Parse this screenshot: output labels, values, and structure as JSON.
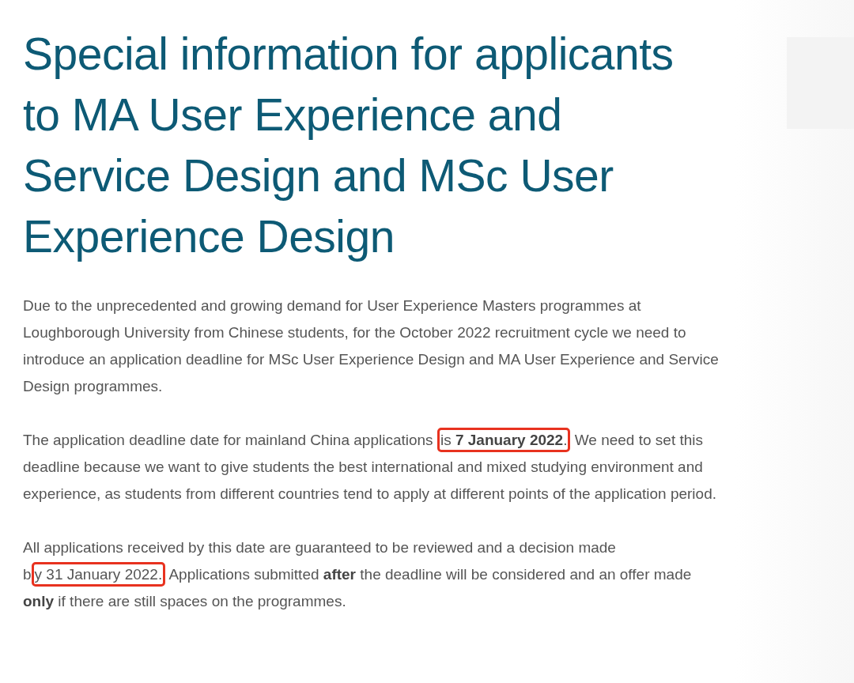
{
  "heading": "Special information for applicants to MA User Experience and Service Design and MSc User Experience Design",
  "paragraphs": [
    {
      "segments": [
        {
          "text": "Due to the unprecedented and growing demand for User Experience Masters programmes at Loughborough University from Chinese students, for the October 2022 recruitment cycle we need to introduce an application deadline for MSc User Experience Design and MA User Experience and Service Design programmes.",
          "highlighted": false
        }
      ]
    },
    {
      "segments": [
        {
          "text": "The application deadline date for mainland China applications ",
          "highlighted": false
        },
        {
          "text": "is **7 January 2022**.",
          "highlighted": true
        },
        {
          "text": " We need to set this deadline because we want to give students the best international and mixed studying environment and experience, as students from different countries tend to apply at different points of the application period.",
          "highlighted": false
        }
      ]
    },
    {
      "segments": [
        {
          "text": "All applications received by this date are guaranteed to be reviewed and a decision made b",
          "highlighted": false
        },
        {
          "text": "y 31 January 2022.",
          "highlighted": true
        },
        {
          "text": " Applications submitted **after** the deadline will be considered and an offer made **only** if there are still spaces on the programmes.",
          "highlighted": false
        }
      ]
    }
  ]
}
